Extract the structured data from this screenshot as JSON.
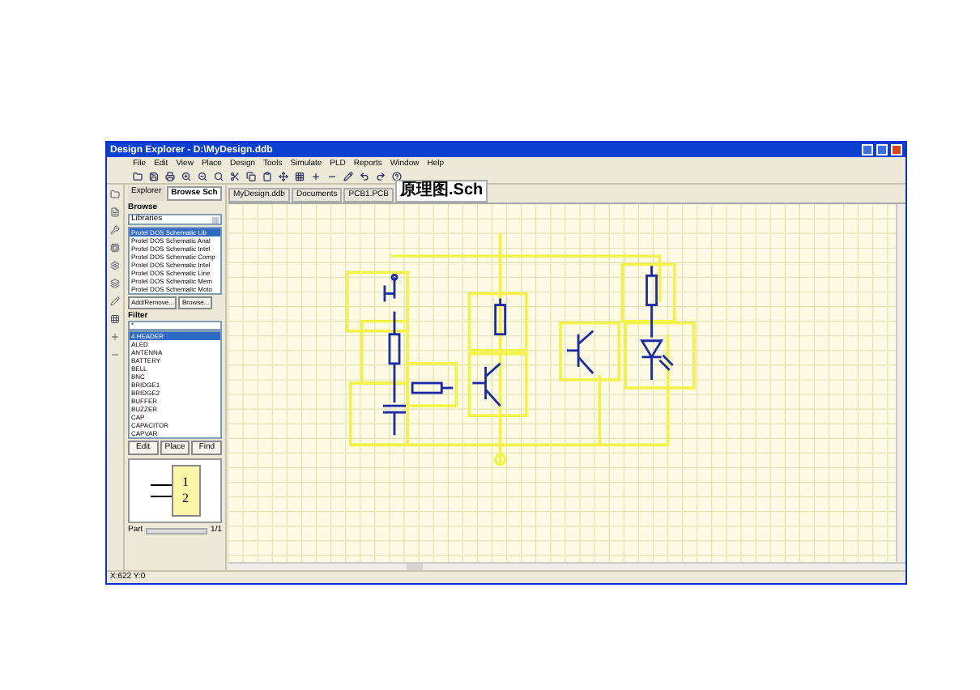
{
  "window": {
    "title": "Design Explorer - D:\\MyDesign.ddb"
  },
  "menu": [
    "File",
    "Edit",
    "View",
    "Place",
    "Design",
    "Tools",
    "Simulate",
    "PLD",
    "Reports",
    "Window",
    "Help"
  ],
  "panel": {
    "tabs": [
      {
        "label": "Explorer",
        "selected": false
      },
      {
        "label": "Browse Sch",
        "selected": true
      }
    ],
    "browse_label": "Browse",
    "browse_select": "Libraries",
    "libraries": [
      {
        "label": "Protel DOS Schematic Lib",
        "selected": true
      },
      {
        "label": "Protel DOS Schematic Anal",
        "selected": false
      },
      {
        "label": "Protel DOS Schematic Intel",
        "selected": false
      },
      {
        "label": "Protel DOS Schematic Comp",
        "selected": false
      },
      {
        "label": "Protel DOS Schematic Intel",
        "selected": false
      },
      {
        "label": "Protel DOS Schematic Line",
        "selected": false
      },
      {
        "label": "Protel DOS Schematic Mem",
        "selected": false
      },
      {
        "label": "Protel DOS Schematic Moto",
        "selected": false
      }
    ],
    "library_buttons": [
      "Add/Remove...",
      "Browse..."
    ],
    "filter_label": "Filter",
    "filter_value": "*",
    "components": [
      {
        "label": "4 HEADER",
        "selected": true
      },
      {
        "label": "ALED",
        "selected": false
      },
      {
        "label": "ANTENNA",
        "selected": false
      },
      {
        "label": "BATTERY",
        "selected": false
      },
      {
        "label": "BELL",
        "selected": false
      },
      {
        "label": "BNC",
        "selected": false
      },
      {
        "label": "BRIDGE1",
        "selected": false
      },
      {
        "label": "BRIDGE2",
        "selected": false
      },
      {
        "label": "BUFFER",
        "selected": false
      },
      {
        "label": "BUZZER",
        "selected": false
      },
      {
        "label": "CAP",
        "selected": false
      },
      {
        "label": "CAPACITOR",
        "selected": false
      },
      {
        "label": "CAPVAR",
        "selected": false
      }
    ],
    "component_buttons": [
      "Edit",
      "Place",
      "Find"
    ],
    "preview_pins": [
      "1",
      "2"
    ],
    "part_label": "Part",
    "part_value": "1/1"
  },
  "doc_tabs": [
    {
      "label": "MyDesign.ddb",
      "selected": false
    },
    {
      "label": "Documents",
      "selected": false
    },
    {
      "label": "PCB1.PCB",
      "selected": false
    },
    {
      "label": "原理图.Sch",
      "selected": true
    }
  ],
  "status_bar": "X:622 Y:0"
}
